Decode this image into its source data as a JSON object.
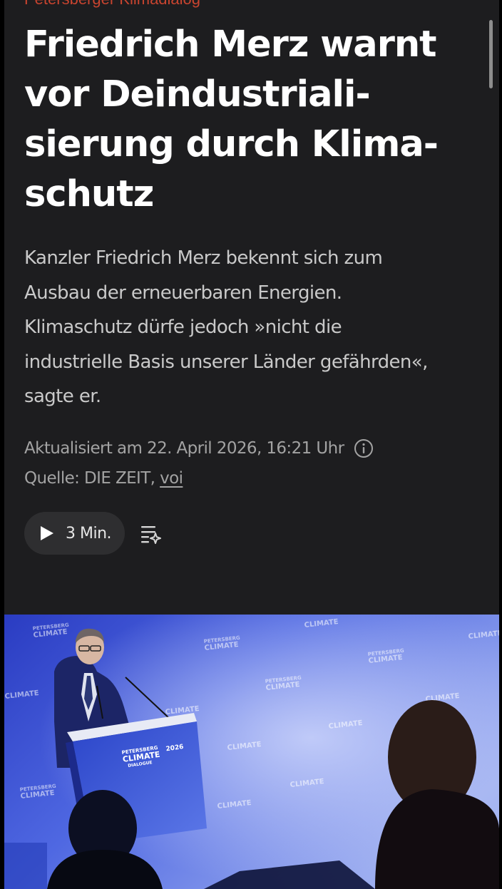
{
  "kicker": "Petersberger Klimadialog",
  "headline": {
    "lines": [
      "Friedrich Merz warnt",
      "vor Deindustriali-",
      "sierung durch Klima-",
      "schutz"
    ]
  },
  "lead": {
    "lines": [
      "Kanzler Friedrich Merz bekennt sich zum",
      "Ausbau der erneuerbaren Energien.",
      "Klimaschutz dürfe jedoch »nicht die",
      "industrielle Basis unserer Länder gefährden«,",
      "sagte er."
    ]
  },
  "meta": {
    "updated": "Aktualisiert am 22. April 2026, 16:21 Uhr",
    "source_prefix": "Quelle: DIE ZEIT, ",
    "source_link": "voi",
    "info_icon": "info-circle-icon"
  },
  "audio": {
    "duration": "3 Min.",
    "play_icon": "play-icon",
    "summary_icon": "text-summary-sparkle-icon"
  },
  "photo": {
    "backdrop_logo_line1": "PETERSBERG",
    "backdrop_logo_line2": "CLIMATE",
    "backdrop_logo_line3": "DIALOGUE",
    "backdrop_logo_year": "2026"
  },
  "colors": {
    "background": "#1d1d1f",
    "kicker": "#c8442f",
    "headline": "#ffffff",
    "lead": "#c9c9c9",
    "meta": "#a3a3a3",
    "pill": "#2e2e30"
  }
}
